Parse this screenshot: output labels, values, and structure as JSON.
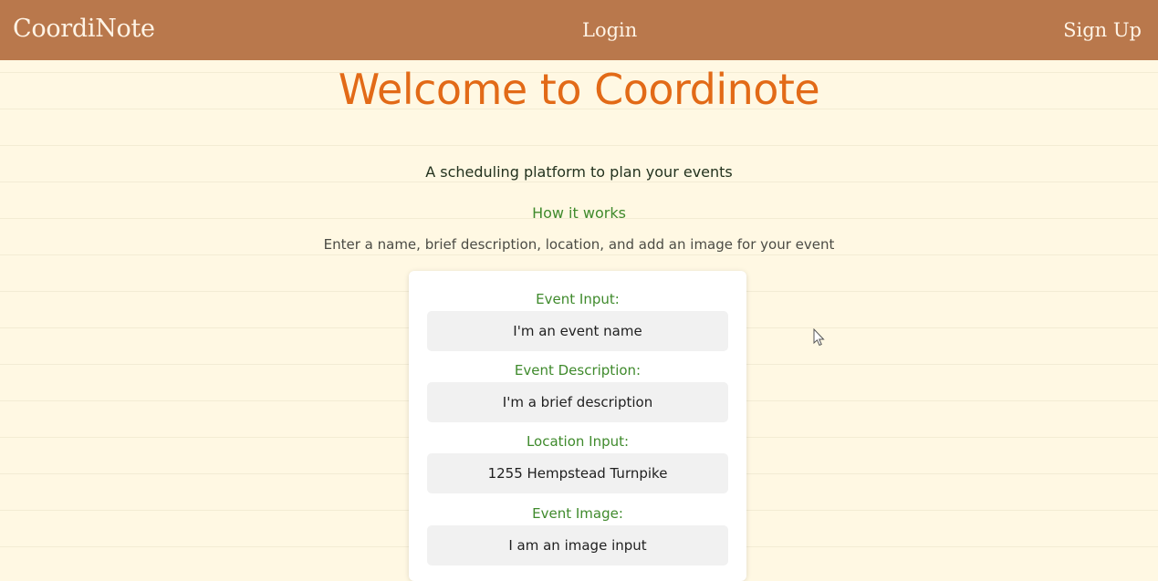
{
  "navbar": {
    "brand": "CoordiNote",
    "login_label": "Login",
    "signup_label": "Sign Up",
    "background_color": "#b9784c"
  },
  "hero": {
    "title": "Welcome to Coordinote",
    "title_color": "#e26a17"
  },
  "intro": {
    "tagline": "A scheduling platform to plan your events",
    "how_heading": "How it works",
    "instructions": "Enter a name, brief description, location, and add an image for your event"
  },
  "form": {
    "fields": [
      {
        "label": "Event Input:",
        "placeholder": "I'm an event name"
      },
      {
        "label": "Event Description:",
        "placeholder": "I'm a brief description"
      },
      {
        "label": "Location Input:",
        "placeholder": "1255 Hempstead Turnpike"
      },
      {
        "label": "Event Image:",
        "placeholder": "I am an image input"
      }
    ],
    "label_color": "#3f8a2c"
  },
  "page": {
    "background_color": "#fff8e3"
  }
}
